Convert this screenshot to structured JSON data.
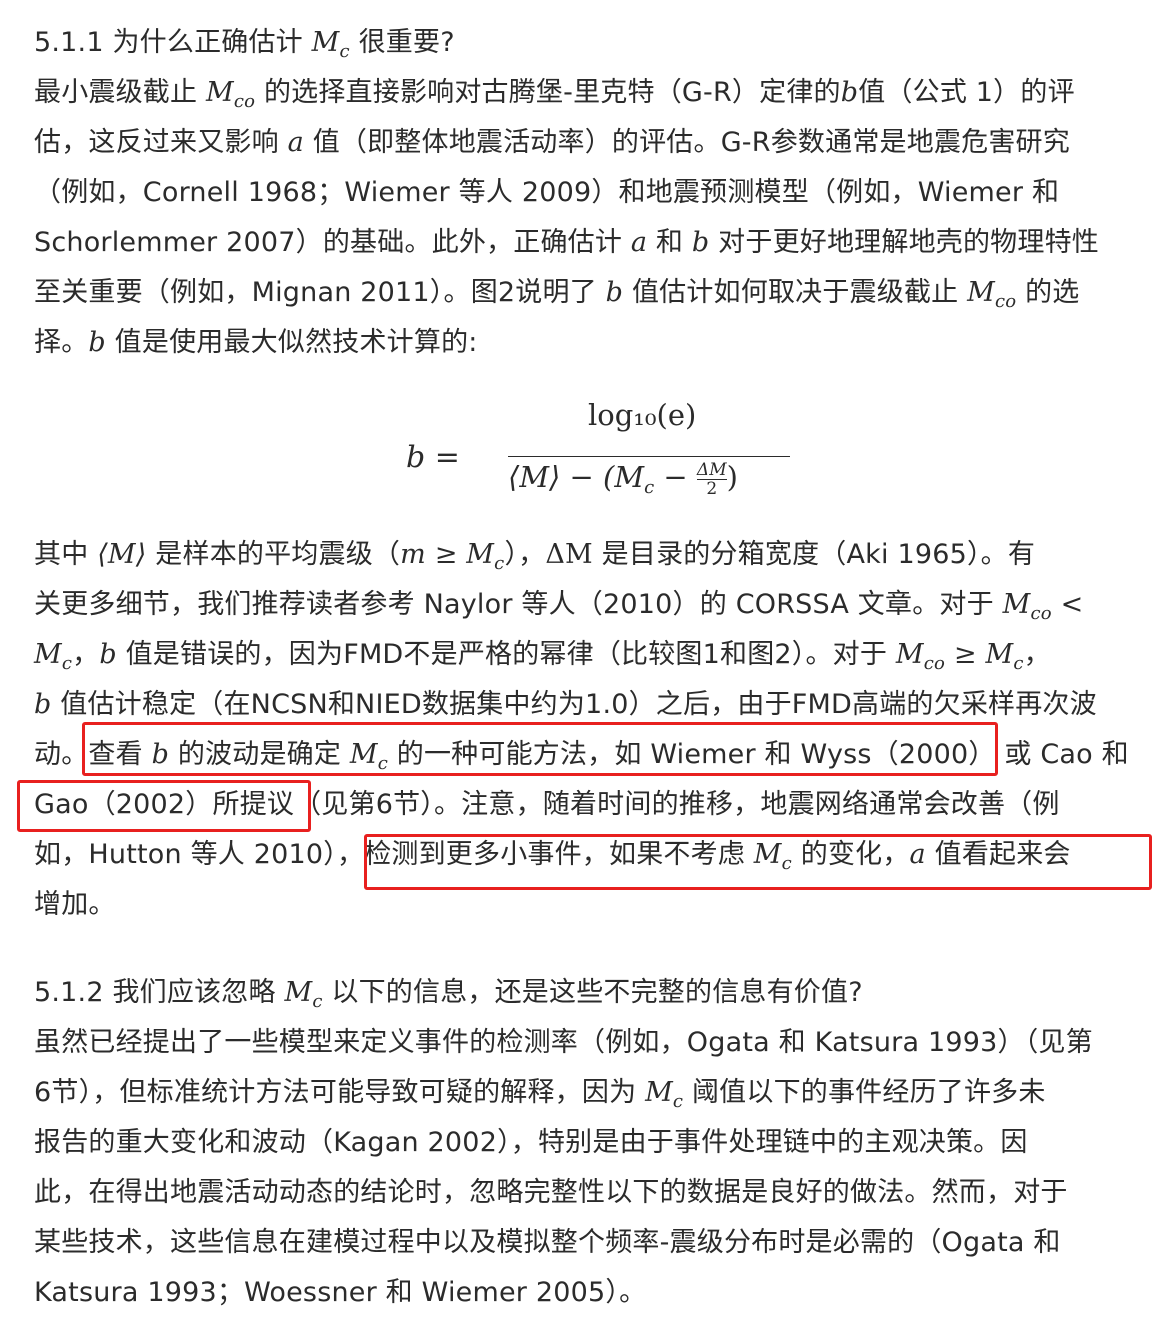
{
  "section1": {
    "heading_prefix": "5.1.1 为什么正确估计 ",
    "heading_suffix": " 很重要?",
    "p1_l1_a": "最小震级截止 ",
    "p1_l1_b": " 的选择直接影响对古腾堡-里克特（G-R）定律的",
    "p1_l1_c": "值（公式 1）的评",
    "p1_l2_a": "估，这反过来又影响 ",
    "p1_l2_b": " 值（即整体地震活动率）的评估。G-R参数通常是地震危害研究",
    "p1_l3": "（例如，Cornell 1968；Wiemer 等人 2009）和地震预测模型（例如，Wiemer 和",
    "p1_l4_a": "Schorlemmer 2007）的基础。此外，正确估计 ",
    "p1_l4_b": " 和 ",
    "p1_l4_c": " 对于更好地理解地壳的物理特性",
    "p1_l5_a": "至关重要（例如，Mignan 2011）。图2说明了 ",
    "p1_l5_b": " 值估计如何取决于震级截止 ",
    "p1_l5_c": " 的选",
    "p1_l6_a": "择。",
    "p1_l6_b": " 值是使用最大似然技术计算的:",
    "p2_l1_a": "其中 ",
    "p2_l1_b": " 是样本的平均震级（",
    "p2_l1_c": "），",
    "p2_l1_d": " 是目录的分箱宽度（Aki 1965）。有",
    "p2_l2": "关更多细节，我们推荐读者参考 Naylor 等人（2010）的 CORSSA 文章。对于 ",
    "p2_l3_a": "，",
    "p2_l3_b": " 值是错误的，因为FMD不是严格的幂律（比较图1和图2）。对于 ",
    "p2_l3_c": "，",
    "p2_l4": " 值估计稳定（在NCSN和NIED数据集中约为1.0）之后，由于FMD高端的欠采样再次波",
    "p2_l5_a": "动。",
    "p2_l5_b": "查看 ",
    "p2_l5_c": " 的波动是确定 ",
    "p2_l5_d": " 的一种可能方法，如 Wiemer 和 Wyss（2000）",
    "p2_l5_e": " 或 Cao 和",
    "p2_l6_a": "Gao（2002）所提议",
    "p2_l6_b": "（见第6节）。注意，随着时间的推移，地震网络通常会改善（例",
    "p2_l7_a": "如，Hutton 等人 2010），",
    "p2_l7_b": "检测到更多小事件，如果不考虑 ",
    "p2_l7_c": " 的变化，",
    "p2_l7_d": " 值看起来会",
    "p2_l8": "增加。"
  },
  "section2": {
    "heading_prefix": "5.1.2 我们应该忽略 ",
    "heading_suffix": " 以下的信息，还是这些不完整的信息有价值?",
    "l1": "虽然已经提出了一些模型来定义事件的检测率（例如，Ogata 和 Katsura 1993）（见第",
    "l2_a": "6节），但标准统计方法可能导致可疑的解释，因为 ",
    "l2_b": " 阈值以下的事件经历了许多未",
    "l3": "报告的重大变化和波动（Kagan 2002），特别是由于事件处理链中的主观决策。因",
    "l4": "此，在得出地震活动动态的结论时，忽略完整性以下的数据是良好的做法。然而，对于",
    "l5": "某些技术，这些信息在建模过程中以及模拟整个频率-震级分布时是必需的（Ogata 和",
    "l6": "Katsura 1993；Woessner 和 Wiemer 2005）。"
  },
  "math": {
    "M": "M",
    "c": "c",
    "co": "co",
    "a": "a",
    "b": "b",
    "mean_M": "⟨M⟩",
    "m_ge_Mc": "m ≥ M",
    "delta_M": "ΔM",
    "Mco_lt": "M",
    "lt": " <",
    "ge": " ≥ ",
    "formula_lhs": "b =",
    "formula_num": "log₁₀(e)",
    "formula_den": "⟨M⟩ − (M",
    "formula_den_mid": " − ",
    "formula_frac_top": "ΔM",
    "formula_frac_bot": "2",
    "formula_close": ")"
  },
  "colors": {
    "highlight_border": "#e8201f",
    "text": "#2b2b2b"
  }
}
